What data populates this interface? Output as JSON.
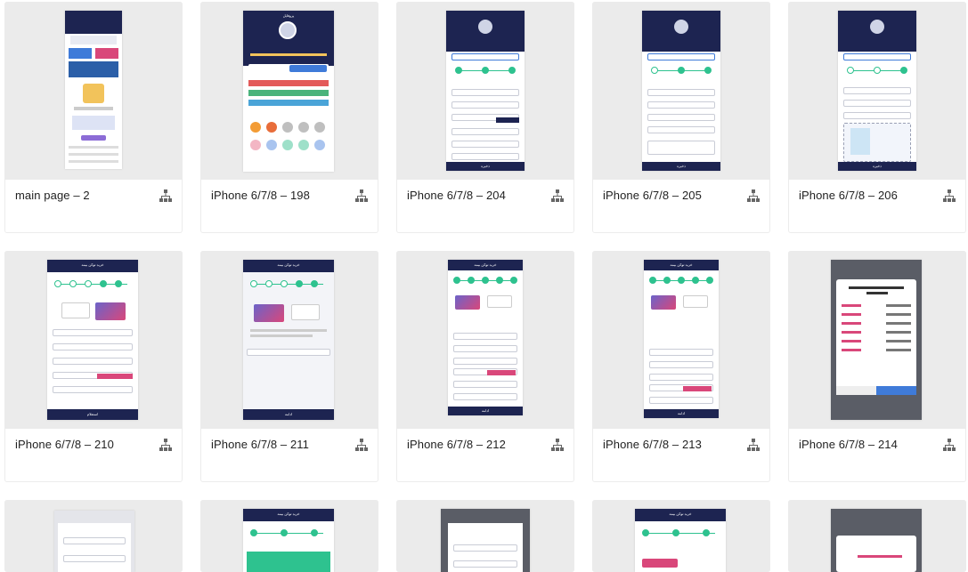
{
  "cards": [
    {
      "label": "main page – 2"
    },
    {
      "label": "iPhone 6/7/8 – 198"
    },
    {
      "label": "iPhone 6/7/8 – 204"
    },
    {
      "label": "iPhone 6/7/8 – 205"
    },
    {
      "label": "iPhone 6/7/8 – 206"
    },
    {
      "label": "iPhone 6/7/8 – 210"
    },
    {
      "label": "iPhone 6/7/8 – 211"
    },
    {
      "label": "iPhone 6/7/8 – 212"
    },
    {
      "label": "iPhone 6/7/8 – 213"
    },
    {
      "label": "iPhone 6/7/8 – 214"
    }
  ],
  "screen_texts": {
    "profile": "پروفایل",
    "insurance_buy": "خرید توکن بیمه",
    "save": "ذخیره",
    "continue": "استعلام",
    "confirm": "ادامه"
  },
  "colors": {
    "navy": "#1d2451",
    "teal": "#2ec28f",
    "pink": "#d9477a",
    "purple": "#6c63c9"
  }
}
